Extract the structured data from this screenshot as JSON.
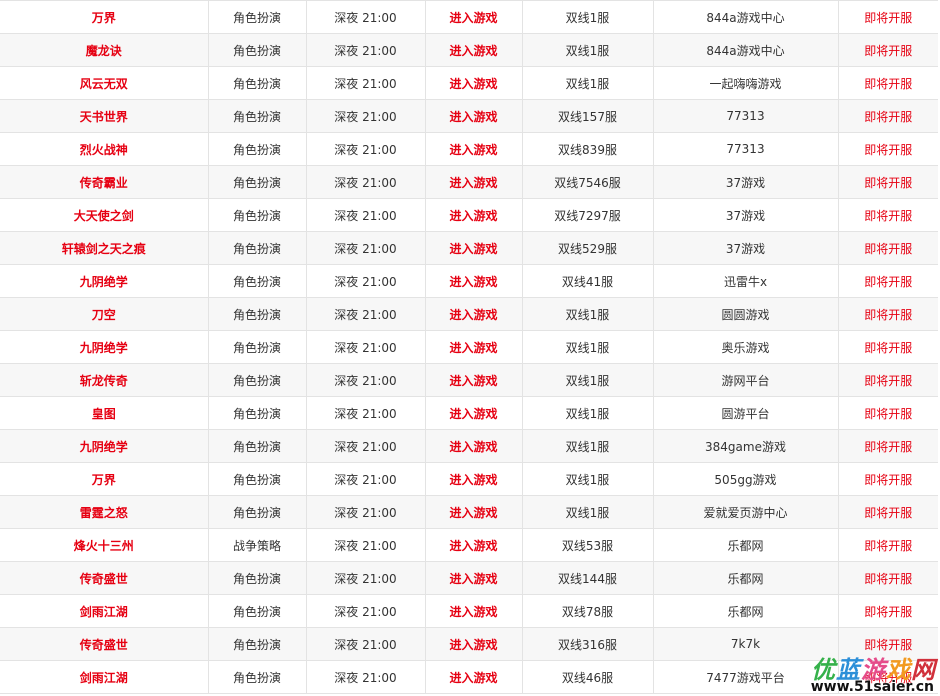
{
  "enter_label": "进入游戏",
  "status_label": "即将开服",
  "rows": [
    {
      "name": "万界",
      "type": "角色扮演",
      "time": "深夜 21:00",
      "server": "双线1服",
      "platform": "844a游戏中心"
    },
    {
      "name": "魔龙诀",
      "type": "角色扮演",
      "time": "深夜 21:00",
      "server": "双线1服",
      "platform": "844a游戏中心"
    },
    {
      "name": "风云无双",
      "type": "角色扮演",
      "time": "深夜 21:00",
      "server": "双线1服",
      "platform": "一起嗨嗨游戏"
    },
    {
      "name": "天书世界",
      "type": "角色扮演",
      "time": "深夜 21:00",
      "server": "双线157服",
      "platform": "77313"
    },
    {
      "name": "烈火战神",
      "type": "角色扮演",
      "time": "深夜 21:00",
      "server": "双线839服",
      "platform": "77313"
    },
    {
      "name": "传奇霸业",
      "type": "角色扮演",
      "time": "深夜 21:00",
      "server": "双线7546服",
      "platform": "37游戏"
    },
    {
      "name": "大天使之剑",
      "type": "角色扮演",
      "time": "深夜 21:00",
      "server": "双线7297服",
      "platform": "37游戏"
    },
    {
      "name": "轩辕剑之天之痕",
      "type": "角色扮演",
      "time": "深夜 21:00",
      "server": "双线529服",
      "platform": "37游戏"
    },
    {
      "name": "九阴绝学",
      "type": "角色扮演",
      "time": "深夜 21:00",
      "server": "双线41服",
      "platform": "迅雷牛x"
    },
    {
      "name": "刀空",
      "type": "角色扮演",
      "time": "深夜 21:00",
      "server": "双线1服",
      "platform": "圆圆游戏"
    },
    {
      "name": "九阴绝学",
      "type": "角色扮演",
      "time": "深夜 21:00",
      "server": "双线1服",
      "platform": "奥乐游戏"
    },
    {
      "name": "斩龙传奇",
      "type": "角色扮演",
      "time": "深夜 21:00",
      "server": "双线1服",
      "platform": "游网平台"
    },
    {
      "name": "皇图",
      "type": "角色扮演",
      "time": "深夜 21:00",
      "server": "双线1服",
      "platform": "圆游平台"
    },
    {
      "name": "九阴绝学",
      "type": "角色扮演",
      "time": "深夜 21:00",
      "server": "双线1服",
      "platform": "384game游戏"
    },
    {
      "name": "万界",
      "type": "角色扮演",
      "time": "深夜 21:00",
      "server": "双线1服",
      "platform": "505gg游戏"
    },
    {
      "name": "雷霆之怒",
      "type": "角色扮演",
      "time": "深夜 21:00",
      "server": "双线1服",
      "platform": "爱就爱页游中心"
    },
    {
      "name": "烽火十三州",
      "type": "战争策略",
      "time": "深夜 21:00",
      "server": "双线53服",
      "platform": "乐都网"
    },
    {
      "name": "传奇盛世",
      "type": "角色扮演",
      "time": "深夜 21:00",
      "server": "双线144服",
      "platform": "乐都网"
    },
    {
      "name": "剑雨江湖",
      "type": "角色扮演",
      "time": "深夜 21:00",
      "server": "双线78服",
      "platform": "乐都网"
    },
    {
      "name": "传奇盛世",
      "type": "角色扮演",
      "time": "深夜 21:00",
      "server": "双线316服",
      "platform": "7k7k"
    },
    {
      "name": "剑雨江湖",
      "type": "角色扮演",
      "time": "深夜 21:00",
      "server": "双线46服",
      "platform": "7477游戏平台"
    }
  ],
  "watermark": {
    "logo_chars": [
      "优",
      "蓝",
      "游",
      "戏",
      "网"
    ],
    "url": "www.51saier.cn"
  },
  "colors": {
    "accent_red": "#e60012",
    "row_alt_bg": "#f7f7f7",
    "border": "#e3e3e3"
  }
}
